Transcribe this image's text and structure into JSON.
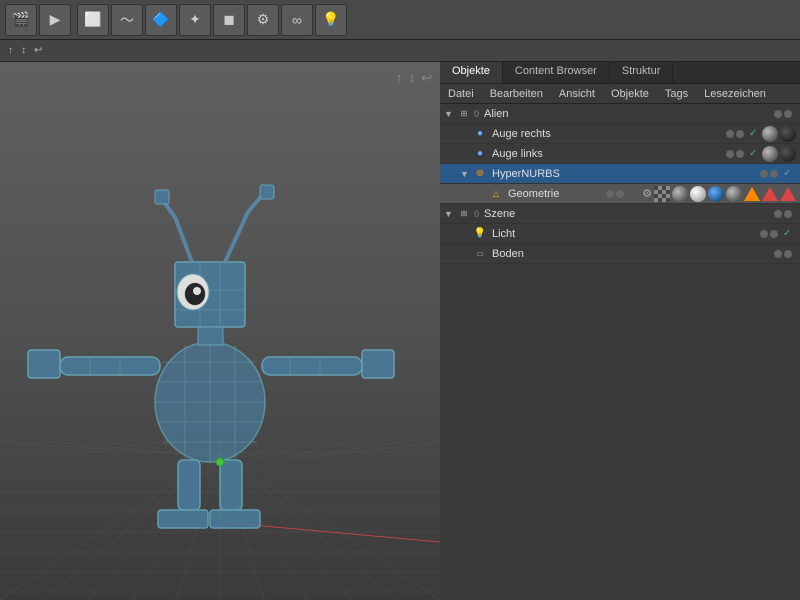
{
  "toolbar": {
    "label": "Toolbar"
  },
  "tabs": {
    "items": [
      {
        "label": "Objekte",
        "active": true
      },
      {
        "label": "Content Browser",
        "active": false
      },
      {
        "label": "Struktur",
        "active": false
      }
    ]
  },
  "menubar": {
    "items": [
      "Datei",
      "Bearbeiten",
      "Ansicht",
      "Objekte",
      "Tags",
      "Lesezeichen"
    ]
  },
  "tree": {
    "rows": [
      {
        "id": "alien",
        "indent": 0,
        "expand": "▼",
        "icon_type": "null_obj",
        "label": "Alien",
        "level_num": "0",
        "dots": [
          "gray",
          "gray"
        ],
        "check": "",
        "materials": []
      },
      {
        "id": "auge-rechts",
        "indent": 1,
        "expand": "",
        "icon_type": "sphere",
        "label": "Auge rechts",
        "level_num": "",
        "dots": [
          "gray",
          "gray"
        ],
        "check": "✓",
        "materials": [
          "sphere",
          "sphere-black"
        ]
      },
      {
        "id": "auge-links",
        "indent": 1,
        "expand": "",
        "icon_type": "sphere",
        "label": "Auge links",
        "level_num": "",
        "dots": [
          "gray",
          "gray"
        ],
        "check": "✓",
        "materials": [
          "sphere",
          "sphere-black"
        ]
      },
      {
        "id": "hypernurbs",
        "indent": 1,
        "expand": "▼",
        "icon_type": "nurbs",
        "label": "HyperNURBS",
        "level_num": "",
        "dots": [
          "gray",
          "gray"
        ],
        "check": "✓",
        "materials": [],
        "selected": true
      },
      {
        "id": "geometrie",
        "indent": 2,
        "expand": "",
        "icon_type": "poly",
        "label": "Geometrie",
        "level_num": "",
        "dots": [
          "gray",
          "gray"
        ],
        "check": "",
        "materials": [
          "gear",
          "checker",
          "sphere",
          "sphere-white",
          "sphere-blue",
          "sphere",
          "tri",
          "tri-red",
          "tri-red"
        ],
        "highlighted": true
      },
      {
        "id": "szene",
        "indent": 0,
        "expand": "▼",
        "icon_type": "null_obj",
        "label": "Szene",
        "level_num": "0",
        "dots": [
          "gray",
          "gray"
        ],
        "check": "",
        "materials": []
      },
      {
        "id": "licht",
        "indent": 1,
        "expand": "",
        "icon_type": "light",
        "label": "Licht",
        "level_num": "",
        "dots": [
          "gray",
          "gray"
        ],
        "check": "✓",
        "materials": []
      },
      {
        "id": "boden",
        "indent": 1,
        "expand": "",
        "icon_type": "floor",
        "label": "Boden",
        "level_num": "",
        "dots": [
          "gray",
          "gray"
        ],
        "check": "",
        "materials": []
      }
    ]
  },
  "viewport": {
    "arrows": [
      "↑",
      "↓",
      "←"
    ]
  }
}
